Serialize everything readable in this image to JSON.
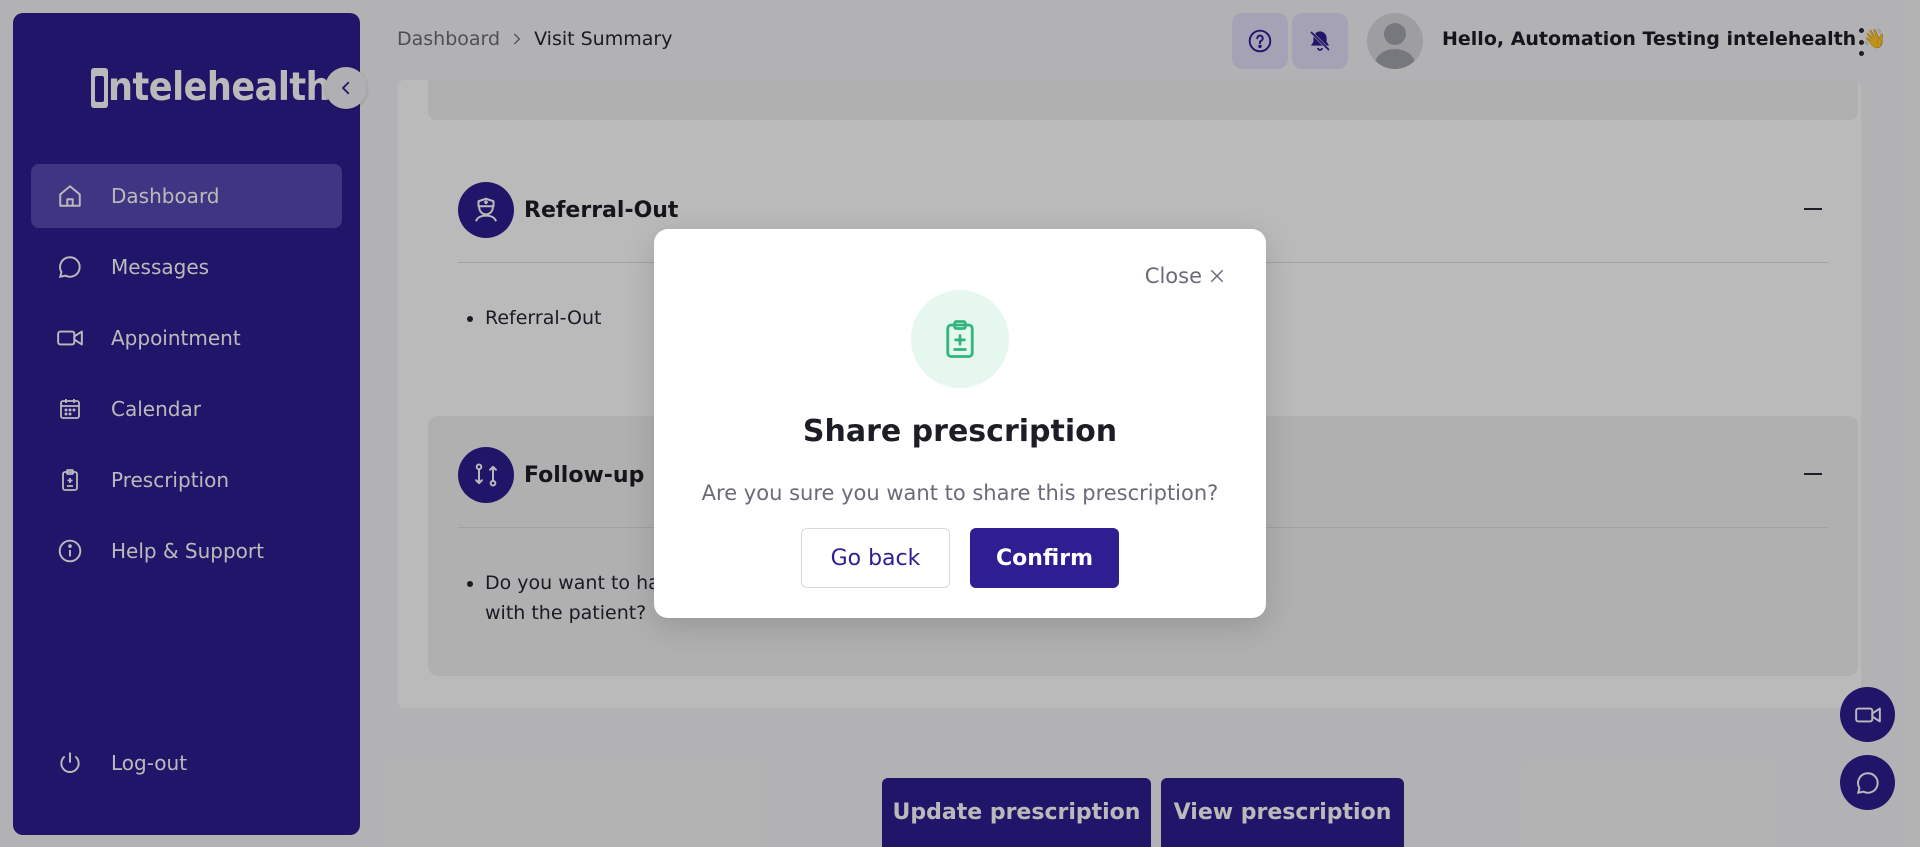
{
  "app": {
    "logo_text": "ntelehealth"
  },
  "sidebar": {
    "items": [
      {
        "label": "Dashboard",
        "icon": "home-icon",
        "active": true
      },
      {
        "label": "Messages",
        "icon": "chat-icon"
      },
      {
        "label": "Appointment",
        "icon": "video-icon"
      },
      {
        "label": "Calendar",
        "icon": "calendar-icon"
      },
      {
        "label": "Prescription",
        "icon": "clipboard-icon"
      },
      {
        "label": "Help & Support",
        "icon": "info-icon"
      }
    ],
    "logout_label": "Log-out"
  },
  "header": {
    "breadcrumb": [
      "Dashboard",
      "Visit Summary"
    ],
    "greeting": "Hello, Automation Testing intelehealth 👋"
  },
  "sections": {
    "referral": {
      "title": "Referral-Out",
      "items": [
        "Referral-Out"
      ]
    },
    "followup": {
      "title": "Follow-up",
      "items": [
        "Do you want to have a follow-up visit",
        "with the patient?"
      ]
    }
  },
  "bottom_buttons": {
    "update": "Update prescription",
    "view": "View prescription"
  },
  "modal": {
    "close_label": "Close",
    "title": "Share prescription",
    "message": "Are you sure you want to share this prescription?",
    "back_label": "Go back",
    "confirm_label": "Confirm"
  },
  "colors": {
    "primary": "#2e1e91",
    "accent_green": "#2fb67c"
  }
}
